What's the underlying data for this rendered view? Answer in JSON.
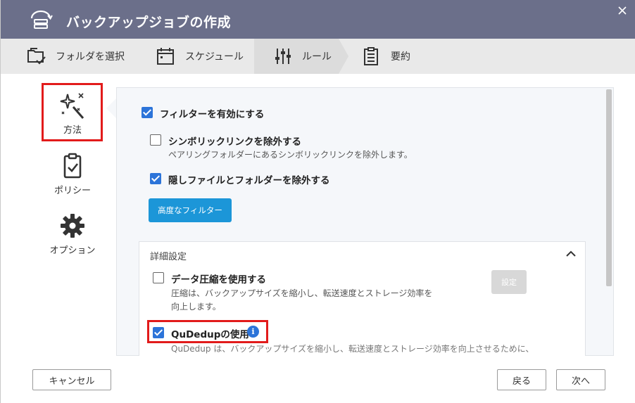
{
  "dialog": {
    "title": "バックアップジョブの作成",
    "close_icon": "close-icon"
  },
  "steps": [
    {
      "label": "フォルダを選択",
      "icon": "folder-check-icon"
    },
    {
      "label": "スケジュール",
      "icon": "calendar-icon"
    },
    {
      "label": "ルール",
      "icon": "sliders-icon",
      "active": true
    },
    {
      "label": "要約",
      "icon": "clipboard-list-icon"
    }
  ],
  "side": {
    "method": "方法",
    "policy": "ポリシー",
    "options": "オプション"
  },
  "filter": {
    "enable_label": "フィルターを有効にする",
    "enable_checked": true,
    "symlink_label": "シンボリックリンクを除外する",
    "symlink_checked": false,
    "symlink_desc": "ペアリングフォルダーにあるシンボリックリンクを除外します。",
    "hidden_label": "隠しファイルとフォルダーを除外する",
    "hidden_checked": true,
    "advanced_button": "高度なフィルター"
  },
  "details": {
    "title": "詳細設定",
    "compress_label": "データ圧縮を使用する",
    "compress_checked": false,
    "compress_desc_1": "圧縮は、バックアップサイズを縮小し、転送速度とストレージ効率を",
    "compress_desc_2": "向上します。",
    "settings_button": "設定",
    "qudedup_label": "QuDedupの使用",
    "qudedup_checked": true,
    "qudedup_desc": "QuDedup は、バックアップサイズを縮小し、転送速度とストレージ効率を向上させるために、"
  },
  "footer": {
    "cancel": "キャンセル",
    "back": "戻る",
    "next": "次へ"
  },
  "colors": {
    "titlebar": "#6b6f8a",
    "accent_blue": "#1c96d8",
    "checkbox_blue": "#2c74d9",
    "highlight_red": "#e21b1b"
  }
}
